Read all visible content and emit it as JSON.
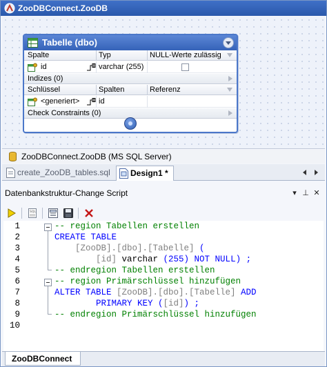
{
  "window": {
    "title": "ZooDBConnect.ZooDB"
  },
  "design": {
    "table": {
      "title": "Tabelle (dbo)",
      "columns_header": [
        "Spalte",
        "Typ",
        "NULL-Werte zulässig"
      ],
      "columns": [
        {
          "name": "id",
          "type": "varchar (255)",
          "nullable": false
        }
      ],
      "indexes_label": "Indizes (0)",
      "keys_header": [
        "Schlüssel",
        "Spalten",
        "Referenz"
      ],
      "keys": [
        {
          "name": "<generiert>",
          "columns": "id",
          "reference": ""
        }
      ],
      "check_constraints_label": "Check Constraints (0)"
    }
  },
  "db_info": {
    "label": "ZooDBConnect.ZooDB (MS SQL Server)"
  },
  "doc_tabs": [
    {
      "label": "create_ZooDB_tables.sql",
      "active": false
    },
    {
      "label": "Design1 *",
      "active": true
    }
  ],
  "script_panel": {
    "title": "Datenbankstruktur-Change Script",
    "line_numbers": [
      "1",
      "2",
      "3",
      "4",
      "5",
      "6",
      "7",
      "8",
      "9",
      "10"
    ],
    "lines": [
      [
        {
          "t": "-- region Tabellen erstellen",
          "c": "comment"
        }
      ],
      [
        {
          "t": "CREATE TABLE",
          "c": "kw"
        }
      ],
      [
        {
          "t": "    [ZooDB].[dbo].[Tabelle] ",
          "c": "id"
        },
        {
          "t": "(",
          "c": "kw"
        }
      ],
      [
        {
          "t": "        [id] ",
          "c": "id"
        },
        {
          "t": "varchar ",
          "c": "plain"
        },
        {
          "t": "(255) NOT NULL) ;",
          "c": "kw"
        }
      ],
      [
        {
          "t": "-- endregion Tabellen erstellen",
          "c": "comment"
        }
      ],
      [
        {
          "t": "-- region Primärschlüssel hinzufügen",
          "c": "comment"
        }
      ],
      [
        {
          "t": "ALTER TABLE ",
          "c": "kw"
        },
        {
          "t": "[ZooDB].[dbo].[Tabelle] ",
          "c": "id"
        },
        {
          "t": "ADD",
          "c": "kw"
        }
      ],
      [
        {
          "t": "        PRIMARY KEY (",
          "c": "kw"
        },
        {
          "t": "[id]",
          "c": "id"
        },
        {
          "t": ") ;",
          "c": "kw"
        }
      ],
      [
        {
          "t": "-- endregion Primärschlüssel hinzufügen",
          "c": "comment"
        }
      ],
      []
    ]
  },
  "bottom_tab": {
    "label": "ZooDBConnect"
  },
  "colors": {
    "accent": "#3563b8",
    "comment": "#008000",
    "keyword": "#0000ff",
    "identifier": "#808080"
  }
}
